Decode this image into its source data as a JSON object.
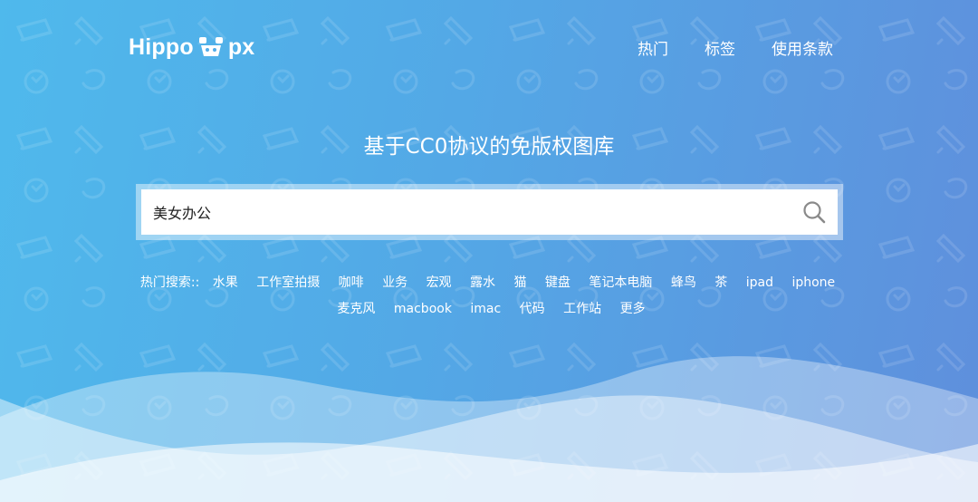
{
  "brand": {
    "left": "Hippo",
    "right": "px"
  },
  "nav": {
    "items": [
      "热门",
      "标签",
      "使用条款"
    ]
  },
  "hero": {
    "tagline": "基于CC0协议的免版权图库"
  },
  "search": {
    "value": "美女办公"
  },
  "hot_search": {
    "label": "热门搜索::",
    "tags": [
      "水果",
      "工作室拍摄",
      "咖啡",
      "业务",
      "宏观",
      "露水",
      "猫",
      "键盘",
      "笔记本电脑",
      "蜂鸟",
      "茶",
      "ipad",
      "iphone",
      "麦克风",
      "macbook",
      "imac",
      "代码",
      "工作站",
      "更多"
    ]
  },
  "colors": {
    "gradient_start": "#4fb9ec",
    "gradient_end": "#5f8fdc",
    "wave": "#ffffff"
  },
  "icons": {
    "search": "magnifier-icon",
    "logo": "hippo-logo-icon"
  }
}
